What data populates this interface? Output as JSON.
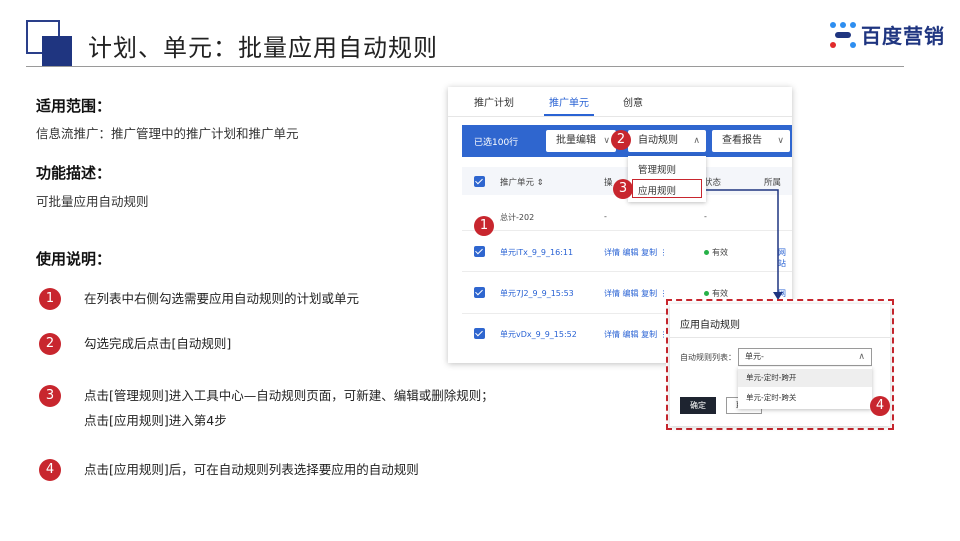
{
  "slide": {
    "title": "计划、单元：批量应用自动规则",
    "brand": "百度营销",
    "brand_colors": {
      "dark": "#1f3580",
      "blue": "#2e8ef0",
      "red": "#e02b2b"
    }
  },
  "sections": {
    "scope_heading": "适用范围：",
    "scope_text": "信息流推广：推广管理中的推广计划和推广单元",
    "feature_heading": "功能描述：",
    "feature_text": "可批量应用自动规则",
    "usage_heading": "使用说明："
  },
  "steps": [
    {
      "num": "1",
      "text": "在列表中右侧勾选需要应用自动规则的计划或单元"
    },
    {
      "num": "2",
      "text": "勾选完成后点击[自动规则]"
    },
    {
      "num": "3",
      "text": "点击[管理规则]进入工具中心—自动规则页面，可新建、编辑或删除规则；",
      "text2": "点击[应用规则]进入第4步"
    },
    {
      "num": "4",
      "text": "点击[应用规则]后，可在自动规则列表选择要应用的自动规则"
    }
  ],
  "ui": {
    "tabs": [
      "推广计划",
      "推广单元",
      "创意"
    ],
    "active_tab": "推广单元",
    "selected_count": "已选100行",
    "toolbar": {
      "bulk_edit": "批量编辑",
      "auto_rule": "自动规则",
      "report": "查看报告"
    },
    "dropdown": [
      "管理规则",
      "应用规则"
    ],
    "table": {
      "headers": [
        "推广单元 ⇕",
        "操",
        "状态",
        "所属"
      ],
      "total_row": {
        "name": "总计-202",
        "op": "-",
        "status": "-"
      },
      "rows": [
        {
          "name": "单元iTx_9_9_16:11",
          "actions": "详情  编辑  复制  ⋮",
          "status": "有效",
          "extra": "网站"
        },
        {
          "name": "单元7J2_9_9_15:53",
          "actions": "详情  编辑  复制  ⋮",
          "status": "有效",
          "extra": "网站"
        },
        {
          "name": "单元vDx_9_9_15:52",
          "actions": "详情  编辑  复制  ⋮",
          "status": "",
          "extra": ""
        }
      ]
    },
    "markers": {
      "m1": "1",
      "m2": "2",
      "m3": "3",
      "m4": "4"
    }
  },
  "dialog": {
    "title": "应用自动规则",
    "field_label": "自动规则列表：",
    "selected_value": "单元-",
    "options": [
      "单元-定时-跨开",
      "单元-定时-跨关"
    ],
    "ok": "确定",
    "cancel": "取消"
  }
}
